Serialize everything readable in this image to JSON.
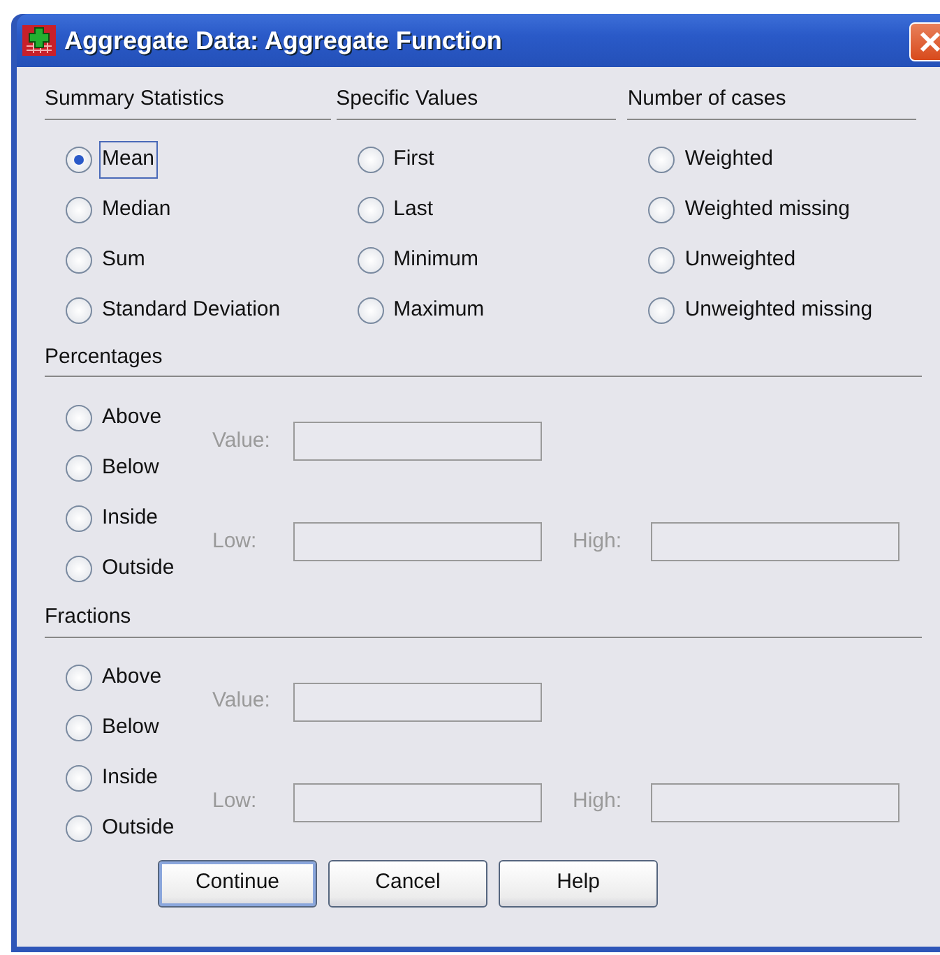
{
  "window": {
    "title": "Aggregate Data: Aggregate Function"
  },
  "groups": [
    {
      "heading": "Summary Statistics",
      "options": [
        {
          "label": "Mean",
          "selected": true,
          "focused": true
        },
        {
          "label": "Median",
          "selected": false,
          "focused": false
        },
        {
          "label": "Sum",
          "selected": false,
          "focused": false
        },
        {
          "label": "Standard Deviation",
          "selected": false,
          "focused": false
        }
      ]
    },
    {
      "heading": "Specific Values",
      "options": [
        {
          "label": "First",
          "selected": false,
          "focused": false
        },
        {
          "label": "Last",
          "selected": false,
          "focused": false
        },
        {
          "label": "Minimum",
          "selected": false,
          "focused": false
        },
        {
          "label": "Maximum",
          "selected": false,
          "focused": false
        }
      ]
    },
    {
      "heading": "Number of cases",
      "options": [
        {
          "label": "Weighted",
          "selected": false,
          "focused": false
        },
        {
          "label": "Weighted missing",
          "selected": false,
          "focused": false
        },
        {
          "label": "Unweighted",
          "selected": false,
          "focused": false
        },
        {
          "label": "Unweighted missing",
          "selected": false,
          "focused": false
        }
      ]
    }
  ],
  "ranges": [
    {
      "heading": "Percentages",
      "options": [
        {
          "label": "Above",
          "selected": false
        },
        {
          "label": "Below",
          "selected": false
        },
        {
          "label": "Inside",
          "selected": false
        },
        {
          "label": "Outside",
          "selected": false
        }
      ],
      "fields": [
        {
          "label": "Value:",
          "disabled": true
        },
        {
          "label": "Low:",
          "disabled": true
        },
        {
          "label": "High:",
          "disabled": true
        }
      ]
    },
    {
      "heading": "Fractions",
      "options": [
        {
          "label": "Above",
          "selected": false
        },
        {
          "label": "Below",
          "selected": false
        },
        {
          "label": "Inside",
          "selected": false
        },
        {
          "label": "Outside",
          "selected": false
        }
      ],
      "fields": [
        {
          "label": "Value:",
          "disabled": true
        },
        {
          "label": "Low:",
          "disabled": true
        },
        {
          "label": "High:",
          "disabled": true
        }
      ]
    }
  ],
  "buttons": [
    {
      "label": "Continue",
      "default": true
    },
    {
      "label": "Cancel",
      "default": false
    },
    {
      "label": "Help",
      "default": false
    }
  ]
}
